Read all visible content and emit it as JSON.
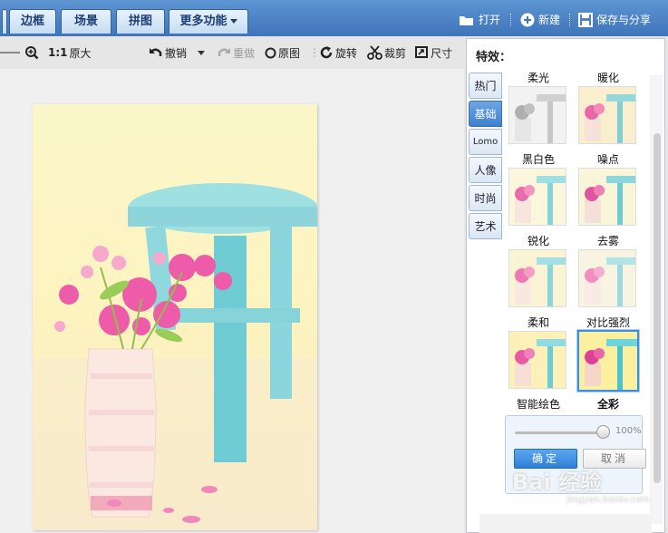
{
  "top_tabs": [
    "边框",
    "场景",
    "拼图",
    "更多功能"
  ],
  "top_actions": {
    "open": "打开",
    "new": "新建",
    "save_share": "保存与分享"
  },
  "toolbar": {
    "zoom_ratio": "1:1",
    "original_size": "原大",
    "undo": "撤销",
    "redo": "重做",
    "original_image": "原图",
    "rotate": "旋转",
    "crop": "裁剪",
    "size": "尺寸"
  },
  "panel": {
    "title": "特效：",
    "categories": [
      "热门",
      "基础",
      "Lomo",
      "人像",
      "时尚",
      "艺术"
    ],
    "active_category": "基础",
    "effects": [
      "柔光",
      "暖化",
      "黑白色",
      "噪点",
      "锐化",
      "去雾",
      "柔和",
      "对比强烈",
      "智能绘色",
      "全彩"
    ],
    "selected_effect": "对比强烈",
    "intensity": "100%",
    "confirm": "确定",
    "cancel": "取消"
  },
  "watermark": {
    "text": "Bai 经验",
    "sub": "jingyan.baidu.com"
  },
  "colors": {
    "topbar": "#3f75ba",
    "accent": "#2f7fd7",
    "active_tab": "#4a8ad6"
  }
}
